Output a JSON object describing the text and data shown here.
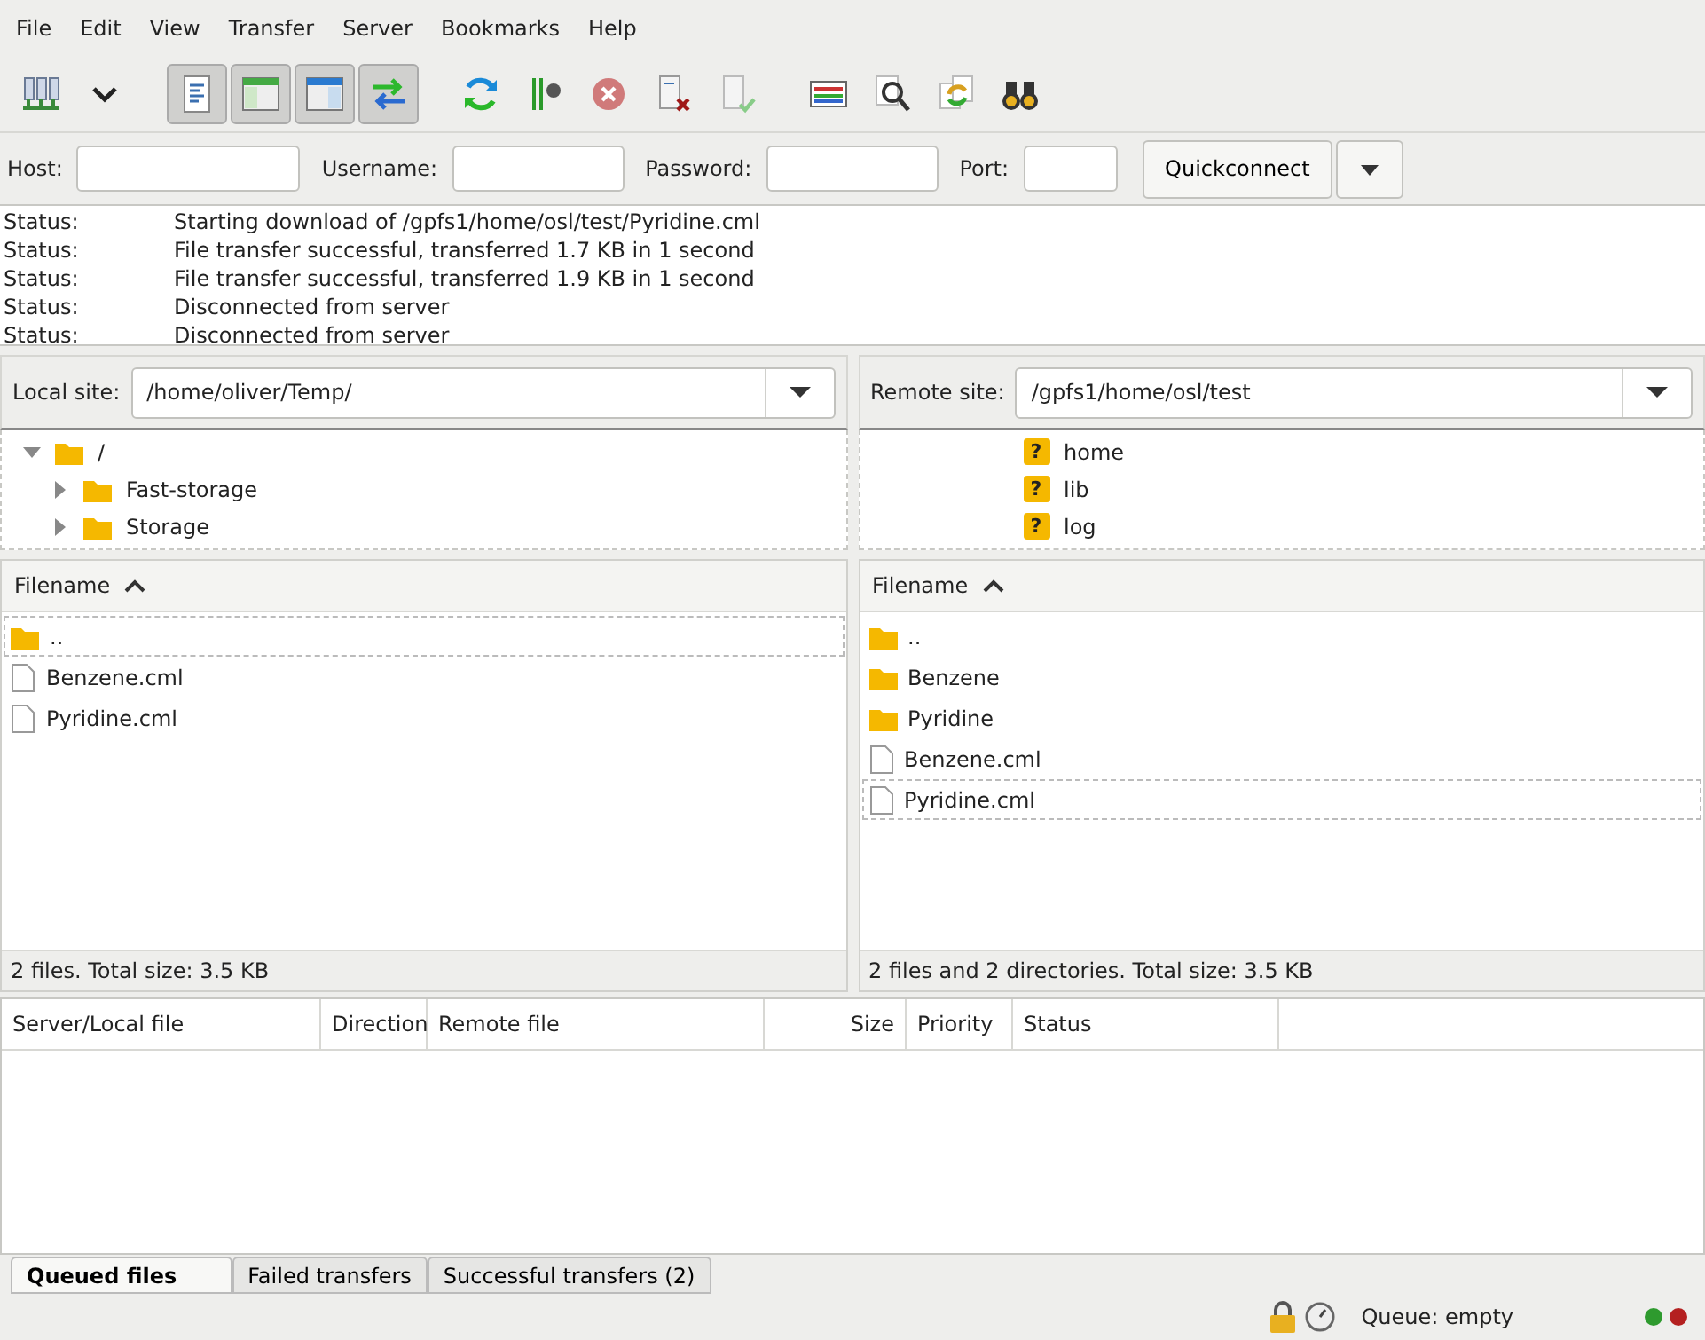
{
  "menu": [
    "File",
    "Edit",
    "View",
    "Transfer",
    "Server",
    "Bookmarks",
    "Help"
  ],
  "toolbar": [
    {
      "kind": "sitemanager",
      "pressed": false
    },
    {
      "kind": "dropdown",
      "pressed": false
    },
    {
      "kind": "log",
      "pressed": true
    },
    {
      "kind": "localtree",
      "pressed": true
    },
    {
      "kind": "remotetree",
      "pressed": true
    },
    {
      "kind": "queue",
      "pressed": true
    },
    {
      "kind": "refresh",
      "pressed": false
    },
    {
      "kind": "filter",
      "pressed": false
    },
    {
      "kind": "cancel",
      "pressed": false
    },
    {
      "kind": "disconnect",
      "pressed": false
    },
    {
      "kind": "reconnect",
      "pressed": false
    },
    {
      "kind": "compare",
      "pressed": false
    },
    {
      "kind": "search",
      "pressed": false
    },
    {
      "kind": "sync",
      "pressed": false
    },
    {
      "kind": "binoculars",
      "pressed": false
    }
  ],
  "quickconnect": {
    "host_label": "Host:",
    "username_label": "Username:",
    "password_label": "Password:",
    "port_label": "Port:",
    "button": "Quickconnect"
  },
  "log": [
    {
      "label": "Status:",
      "message": "Starting download of /gpfs1/home/osl/test/Pyridine.cml"
    },
    {
      "label": "Status:",
      "message": "File transfer successful, transferred 1.7 KB in 1 second"
    },
    {
      "label": "Status:",
      "message": "File transfer successful, transferred 1.9 KB in 1 second"
    },
    {
      "label": "Status:",
      "message": "Disconnected from server"
    },
    {
      "label": "Status:",
      "message": "Disconnected from server"
    }
  ],
  "local": {
    "site_label": "Local site:",
    "path": "/home/oliver/Temp/",
    "tree": [
      {
        "name": "/",
        "kind": "folder",
        "expanded": true,
        "children": [
          {
            "name": "Fast-storage",
            "kind": "folder",
            "expanded": false
          },
          {
            "name": "Storage",
            "kind": "folder",
            "expanded": false
          }
        ]
      }
    ],
    "column": "Filename",
    "files": [
      {
        "name": "..",
        "kind": "folder",
        "focused": true
      },
      {
        "name": "Benzene.cml",
        "kind": "file",
        "focused": false
      },
      {
        "name": "Pyridine.cml",
        "kind": "file",
        "focused": false
      }
    ],
    "summary": "2 files. Total size: 3.5 KB"
  },
  "remote": {
    "site_label": "Remote site:",
    "path": "/gpfs1/home/osl/test",
    "tree": [
      {
        "name": "home",
        "kind": "unknown",
        "badge": "?"
      },
      {
        "name": "lib",
        "kind": "unknown",
        "badge": "?"
      },
      {
        "name": "log",
        "kind": "unknown",
        "badge": "?"
      }
    ],
    "column": "Filename",
    "files": [
      {
        "name": "..",
        "kind": "folder",
        "focused": false
      },
      {
        "name": "Benzene",
        "kind": "folder",
        "focused": false
      },
      {
        "name": "Pyridine",
        "kind": "folder",
        "focused": false
      },
      {
        "name": "Benzene.cml",
        "kind": "file",
        "focused": false
      },
      {
        "name": "Pyridine.cml",
        "kind": "file",
        "focused": true
      }
    ],
    "summary": "2 files and 2 directories. Total size: 3.5 KB"
  },
  "queue": {
    "columns": [
      "Server/Local file",
      "Direction",
      "Remote file",
      "Size",
      "Priority",
      "Status"
    ],
    "tabs": [
      {
        "label": "Queued files",
        "selected": true
      },
      {
        "label": "Failed transfers",
        "selected": false
      },
      {
        "label": "Successful transfers (2)",
        "selected": false
      }
    ]
  },
  "status_bar": {
    "queue": "Queue: empty",
    "lights": [
      {
        "color": "#2e9a2e"
      },
      {
        "color": "#b42020"
      }
    ]
  }
}
